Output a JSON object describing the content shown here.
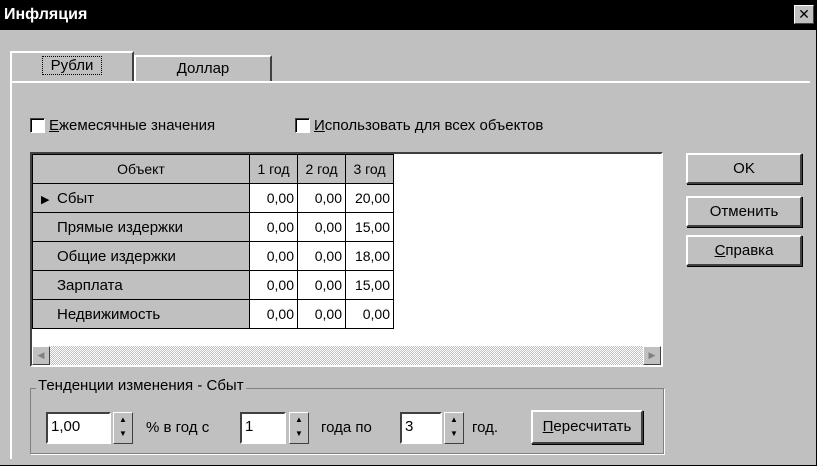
{
  "window": {
    "title": "Инфляция",
    "close_glyph": "✕"
  },
  "tabs": [
    {
      "label": "Рубли",
      "selected": true
    },
    {
      "label": "Доллар",
      "selected": false
    }
  ],
  "options": {
    "monthly_label": "Ежемесячные значения",
    "monthly_accel": "Е",
    "monthly_rest": "жемесячные значения",
    "all_objects_accel": "И",
    "all_objects_rest": "спользовать для всех объектов",
    "monthly_checked": false,
    "all_objects_checked": false
  },
  "grid": {
    "columns": [
      "Объект",
      "1 год",
      "2 год",
      "3 год"
    ],
    "current_row_indicator": "▶",
    "rows": [
      {
        "name": "Сбыт",
        "values": [
          "0,00",
          "0,00",
          "20,00"
        ]
      },
      {
        "name": "Прямые издержки",
        "values": [
          "0,00",
          "0,00",
          "15,00"
        ]
      },
      {
        "name": "Общие издержки",
        "values": [
          "0,00",
          "0,00",
          "18,00"
        ]
      },
      {
        "name": "Зарплата",
        "values": [
          "0,00",
          "0,00",
          "15,00"
        ]
      },
      {
        "name": "Недвижимость",
        "values": [
          "0,00",
          "0,00",
          "0,00"
        ]
      }
    ]
  },
  "buttons": {
    "ok": "OK",
    "cancel": "Отменить",
    "help_accel": "С",
    "help_rest": "правка",
    "recalc_accel": "П",
    "recalc_rest": "ересчитать"
  },
  "trend": {
    "group_label": "Тенденции изменения - Сбыт",
    "rate_value": "1,00",
    "percent_label": "% в год  с",
    "from_value": "1",
    "from_suffix": "года  по",
    "to_value": "3",
    "to_suffix": "год."
  },
  "colors": {
    "titlebar": "#000000",
    "face": "#c0c0c0"
  }
}
